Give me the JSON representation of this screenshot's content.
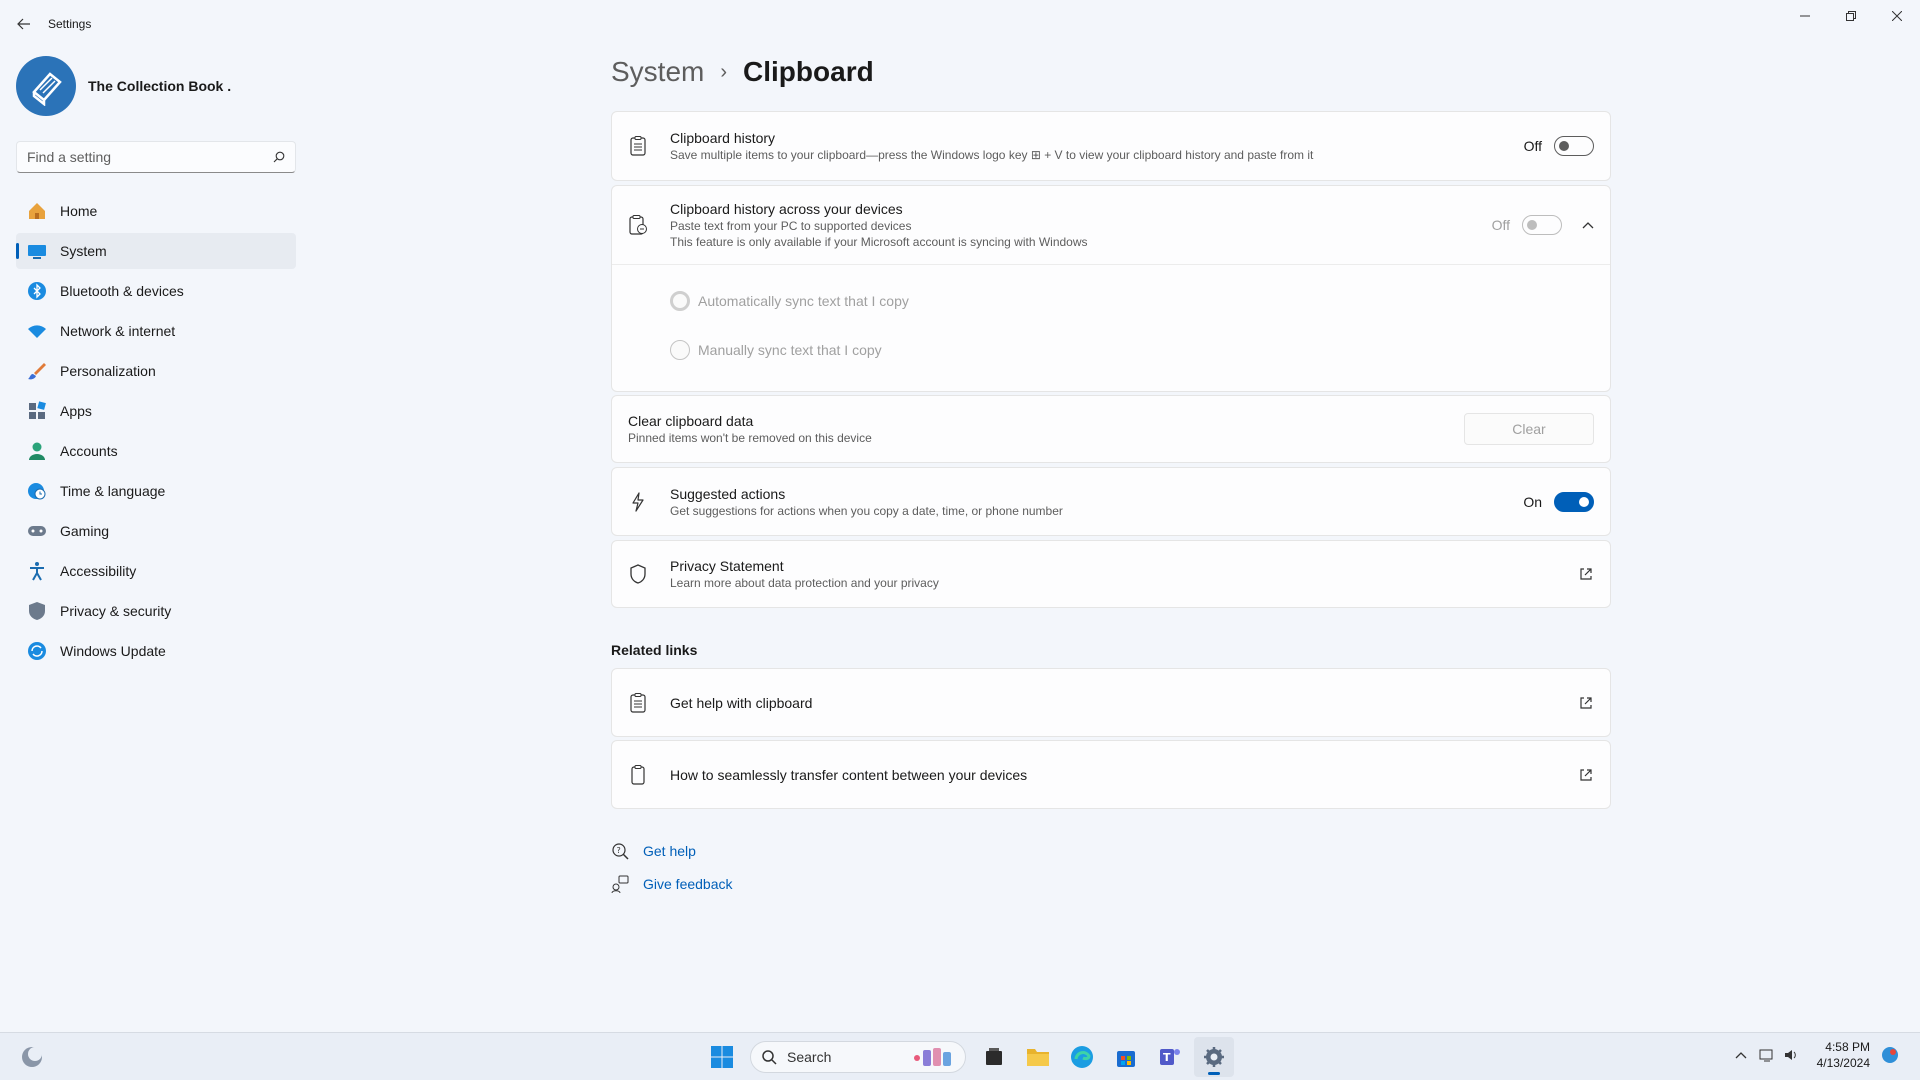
{
  "app": {
    "title": "Settings"
  },
  "profile": {
    "name": "The Collection Book ."
  },
  "search": {
    "placeholder": "Find a setting"
  },
  "sidebar": {
    "items": [
      {
        "label": "Home"
      },
      {
        "label": "System"
      },
      {
        "label": "Bluetooth & devices"
      },
      {
        "label": "Network & internet"
      },
      {
        "label": "Personalization"
      },
      {
        "label": "Apps"
      },
      {
        "label": "Accounts"
      },
      {
        "label": "Time & language"
      },
      {
        "label": "Gaming"
      },
      {
        "label": "Accessibility"
      },
      {
        "label": "Privacy & security"
      },
      {
        "label": "Windows Update"
      }
    ]
  },
  "breadcrumb": {
    "parent": "System",
    "current": "Clipboard"
  },
  "settings": {
    "history": {
      "title": "Clipboard history",
      "desc": "Save multiple items to your clipboard—press the Windows logo key ⊞ + V to view your clipboard history and paste from it",
      "state": "Off"
    },
    "devices": {
      "title": "Clipboard history across your devices",
      "desc1": "Paste text from your PC to supported devices",
      "desc2": "This feature is only available if your Microsoft account is syncing with Windows",
      "state": "Off",
      "options": [
        "Automatically sync text that I copy",
        "Manually sync text that I copy"
      ]
    },
    "clear": {
      "title": "Clear clipboard data",
      "desc": "Pinned items won't be removed on this device",
      "button": "Clear"
    },
    "suggested": {
      "title": "Suggested actions",
      "desc": "Get suggestions for actions when you copy a date, time, or phone number",
      "state": "On"
    },
    "privacy": {
      "title": "Privacy Statement",
      "desc": "Learn more about data protection and your privacy"
    }
  },
  "related": {
    "title": "Related links",
    "links": [
      "Get help with clipboard",
      "How to seamlessly transfer content between your devices"
    ]
  },
  "help": {
    "get_help": "Get help",
    "feedback": "Give feedback"
  },
  "taskbar": {
    "search_label": "Search",
    "time": "4:58 PM",
    "date": "4/13/2024"
  },
  "colors": {
    "accent": "#005fb8",
    "background": "#f3f6fb"
  }
}
